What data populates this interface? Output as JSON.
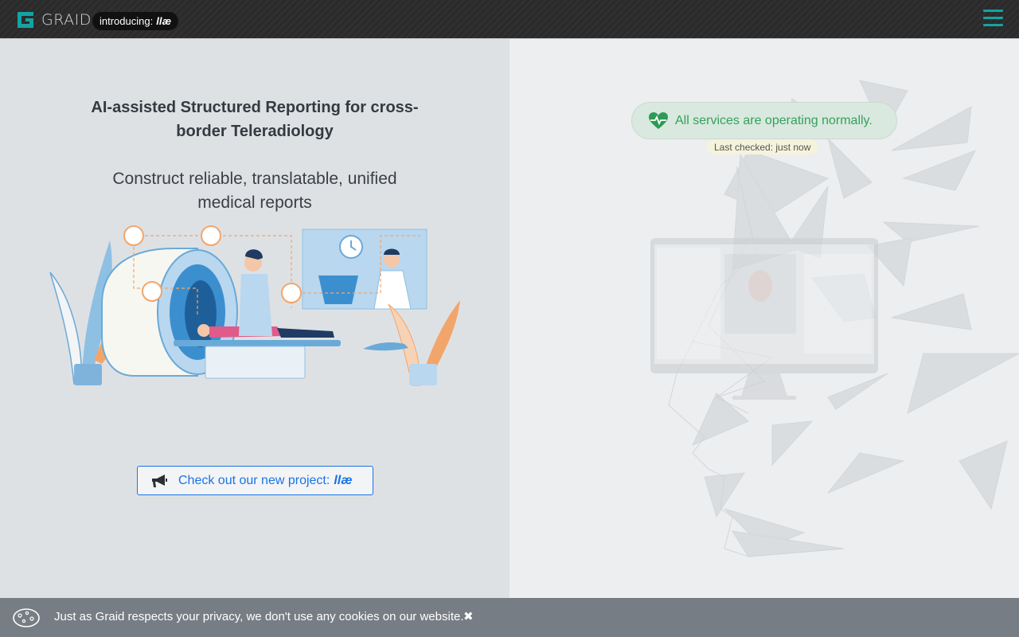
{
  "header": {
    "logo_text": "GRAID",
    "pill_prefix": "introducing:",
    "pill_brand": "llæ"
  },
  "hero": {
    "headline": "AI-assisted Structured Reporting for cross-border Teleradiology",
    "subline": "Construct reliable, translatable, unified medical reports",
    "cta_prefix": "Check out our new project:",
    "cta_brand": "llæ"
  },
  "status": {
    "message": "All services are operating normally.",
    "last_checked": "Last checked: just now"
  },
  "cookie": {
    "message": "Just as Graid respects your privacy, we don't use any cookies on our website.",
    "close_glyph": "✖"
  },
  "colors": {
    "accent": "#14a3a3",
    "link": "#1a73e8",
    "status_green": "#35a05a",
    "illustration_orange": "#f2a56b",
    "illustration_blue": "#6aaad8"
  },
  "icons": {
    "menu": "hamburger-icon",
    "cta": "megaphone-icon",
    "status": "heartbeat-icon",
    "cookie": "cookie-icon",
    "close": "close-icon"
  }
}
